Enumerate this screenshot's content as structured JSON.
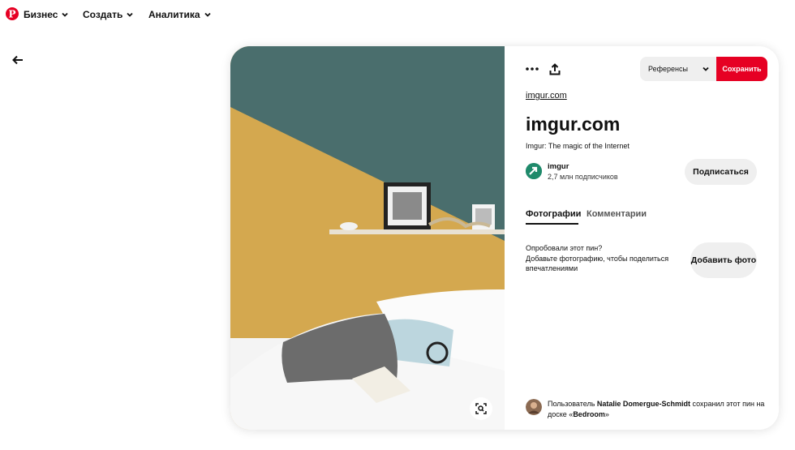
{
  "nav": {
    "logo": "pinterest-logo",
    "items": [
      {
        "label": "Бизнес"
      },
      {
        "label": "Создать"
      },
      {
        "label": "Аналитика"
      }
    ]
  },
  "pin": {
    "board_select_label": "Референсы",
    "save_label": "Сохранить",
    "source_link": "imgur.com",
    "title": "imgur.com",
    "description": "Imgur: The magic of the Internet",
    "author": {
      "name": "imgur",
      "subscribers": "2,7 млн подписчиков",
      "subscribe_label": "Подписаться"
    },
    "tabs": [
      {
        "label": "Фотографии",
        "active": true
      },
      {
        "label": "Комментарии",
        "active": false
      }
    ],
    "try_prompt": {
      "line1": "Опробовали этот пин?",
      "line2": "Добавьте фотографию, чтобы поделиться впечатлениями"
    },
    "add_photo_label": "Добавить фото",
    "saved_by": {
      "prefix": "Пользователь",
      "user": "Natalie Domergue-Schmidt",
      "middle": "сохранил этот пин на доске «",
      "board": "Bedroom",
      "suffix": "»"
    }
  },
  "colors": {
    "accent": "#e60023",
    "wall_teal": "#4a6e6d",
    "wall_mustard": "#d4a84f"
  }
}
